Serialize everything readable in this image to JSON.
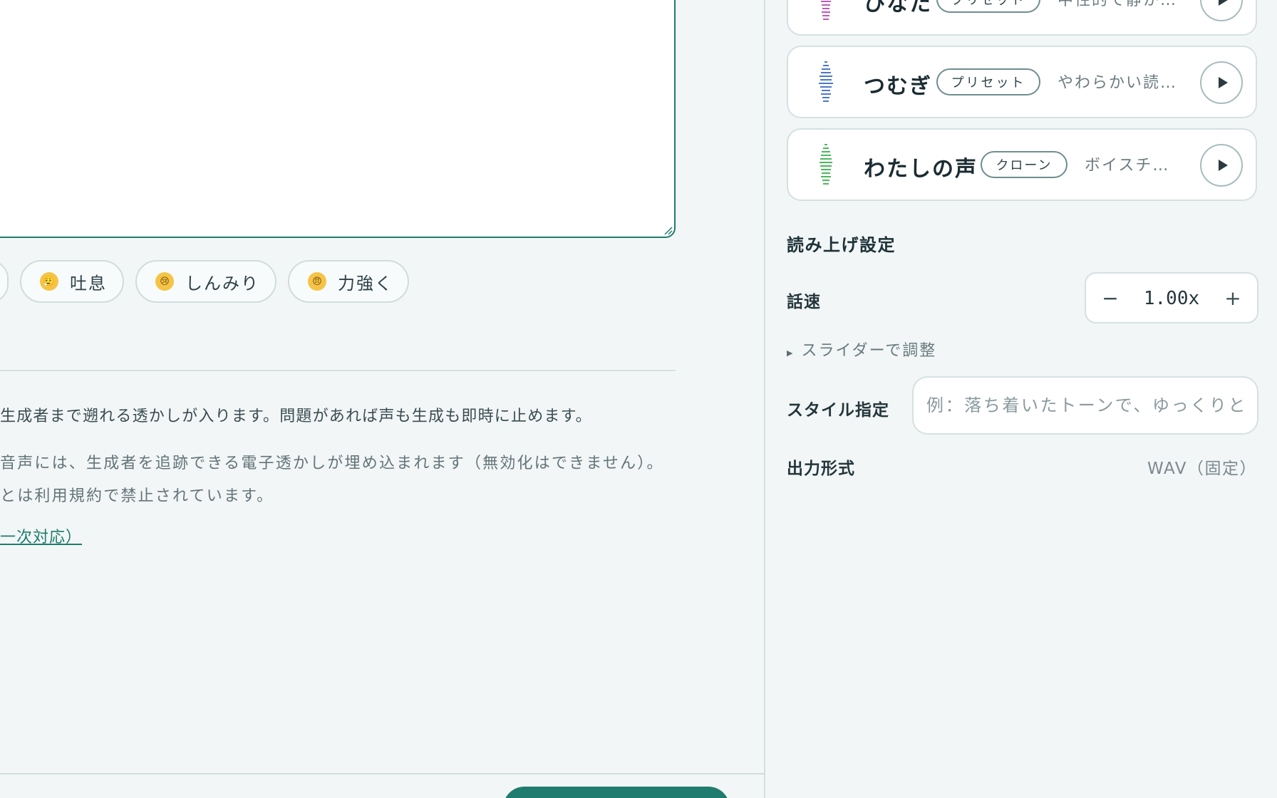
{
  "chips": {
    "items": [
      {
        "emoji": "😮‍💨",
        "label": "吐息"
      },
      {
        "emoji": "😢",
        "label": "しんみり"
      },
      {
        "emoji": "😠",
        "label": "力強く"
      }
    ]
  },
  "notice": {
    "main": "生成者まで遡れる透かしが入ります。問題があれば声も生成も即時に止めます。",
    "sub_line1": "音声には、生成者を追跡できる電子透かしが埋め込まれます（無効化はできません）。",
    "sub_line2": "とは利用規約で禁止されています。",
    "link": "一次対応）"
  },
  "voices": [
    {
      "name": "ひなた",
      "badge": "プリセット",
      "desc": "中性的で静か…",
      "color": "#c05ab8"
    },
    {
      "name": "つむぎ",
      "badge": "プリセット",
      "desc": "やわらかい読…",
      "color": "#4e78c8"
    },
    {
      "name": "わたしの声",
      "badge": "クローン",
      "desc": "ボイスチ…",
      "color": "#4cb85c"
    }
  ],
  "settings": {
    "title": "読み上げ設定",
    "speed_label": "話速",
    "speed_value": "1.00x",
    "minus": "−",
    "plus": "+",
    "slider_toggle": "スライダーで調整",
    "style_label": "スタイル指定",
    "style_placeholder": "例：落ち着いたトーンで、ゆっくりと",
    "format_label": "出力形式",
    "format_value": "WAV（固定）"
  },
  "colors": {
    "accent": "#1f7c6e",
    "background": "#f2f6f6"
  },
  "icons": {
    "play": "play-icon",
    "avatar": "voice-avatar-icon",
    "slider_caret": "caret-right-icon"
  }
}
